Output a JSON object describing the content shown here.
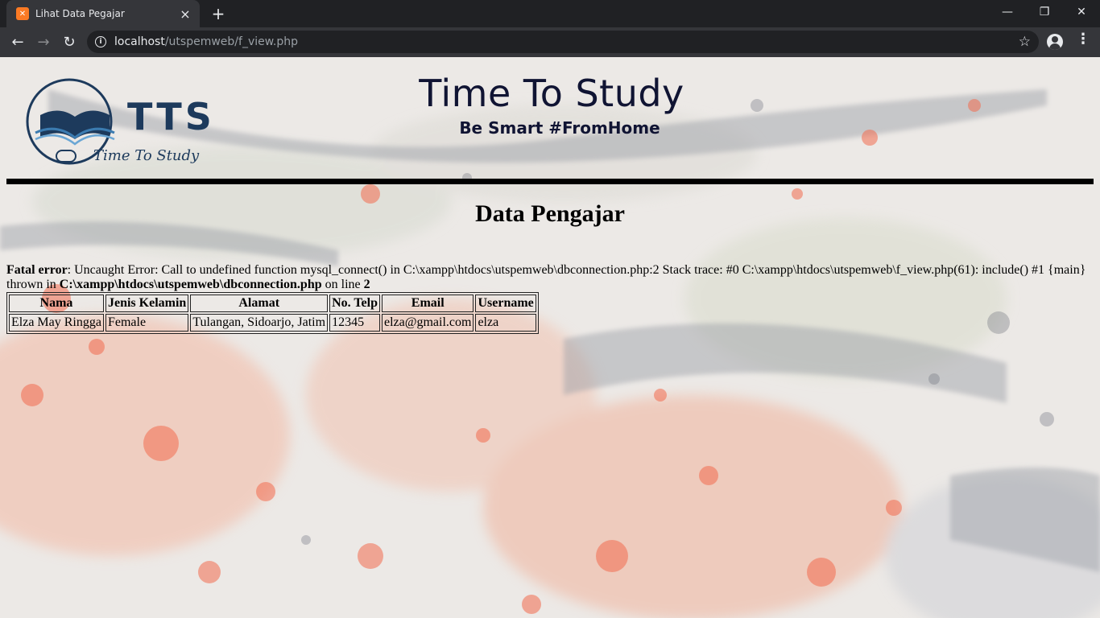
{
  "browser": {
    "tab_title": "Lihat Data Pegajar",
    "url_host": "localhost",
    "url_path": "/utspemweb/f_view.php"
  },
  "header": {
    "logo_text": "TTS",
    "logo_subtext": "Time To Study",
    "title": "Time To Study",
    "tagline": "Be Smart #FromHome"
  },
  "main": {
    "heading": "Data Pengajar",
    "error": {
      "label": "Fatal error",
      "message": ": Uncaught Error: Call to undefined function mysql_connect() in C:\\xampp\\htdocs\\utspemweb\\dbconnection.php:2 Stack trace: #0 C:\\xampp\\htdocs\\utspemweb\\f_view.php(61): include() #1 {main}",
      "thrown_in": "thrown in ",
      "file": "C:\\xampp\\htdocs\\utspemweb\\dbconnection.php",
      "on_line": " on line ",
      "line": "2"
    },
    "table": {
      "headers": [
        "Nama",
        "Jenis Kelamin",
        "Alamat",
        "No. Telp",
        "Email",
        "Username"
      ],
      "rows": [
        [
          "Elza May Ringga",
          "Female",
          "Tulangan, Sidoarjo, Jatim",
          "12345",
          "elza@gmail.com",
          "elza"
        ]
      ]
    }
  }
}
